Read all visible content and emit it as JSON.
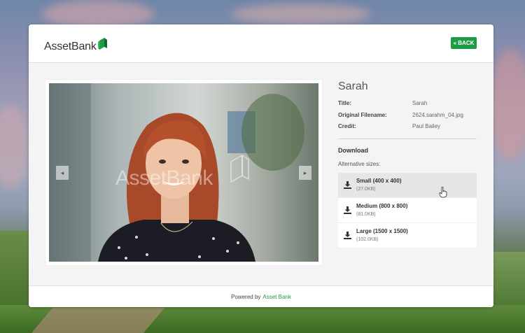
{
  "header": {
    "logo_text": "AssetBank",
    "back_label": "« BACK"
  },
  "preview": {
    "watermark_text": "AssetBank",
    "prev_arrow": "◂",
    "next_arrow": "▸"
  },
  "asset": {
    "name": "Sarah",
    "fields": [
      {
        "label": "Title:",
        "value": "Sarah"
      },
      {
        "label": "Original Filename:",
        "value": "2624.sarahm_04.jpg"
      },
      {
        "label": "Credit:",
        "value": "Paul Bailey"
      }
    ]
  },
  "download": {
    "heading": "Download",
    "subheading": "Alternative sizes:",
    "options": [
      {
        "label": "Small (400 x 400)",
        "size": "(27.0KB)"
      },
      {
        "label": "Medium (800 x 800)",
        "size": "(81.0KB)"
      },
      {
        "label": "Large (1500 x 1500)",
        "size": "(102.0KB)"
      }
    ]
  },
  "footer": {
    "powered_by": "Powered by",
    "link_text": "Asset Bank"
  },
  "colors": {
    "accent": "#1e9b45",
    "card_bg": "#f4f4f4",
    "hover_bg": "#e6e6e6"
  }
}
